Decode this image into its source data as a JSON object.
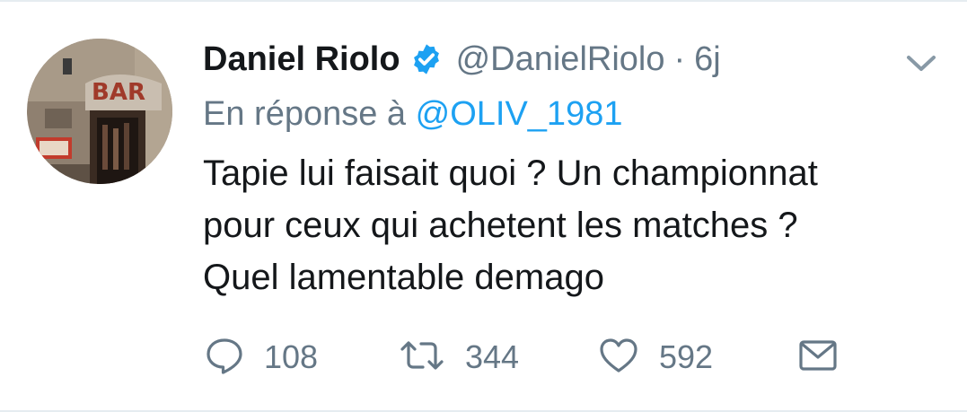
{
  "tweet": {
    "author": {
      "display_name": "Daniel Riolo",
      "handle": "@DanielRiolo",
      "verified": true
    },
    "separator": "·",
    "time": "6j",
    "reply_prefix": "En réponse à",
    "reply_to": "@OLIV_1981",
    "text_lines": [
      "Tapie lui faisait quoi ? Un championnat",
      "pour ceux qui achetent les matches ?",
      "Quel lamentable demago"
    ],
    "counts": {
      "replies": "108",
      "retweets": "344",
      "likes": "592"
    },
    "avatar_sign_text": "BAR"
  },
  "colors": {
    "name": "#14171a",
    "secondary": "#657786",
    "link": "#1da1f2",
    "verified_badge": "#1da1f2",
    "divider": "#e6ecf0"
  },
  "icons": {
    "reply": "speech-bubble-icon",
    "retweet": "retweet-arrows-icon",
    "like": "heart-icon",
    "direct_message": "envelope-icon",
    "menu": "chevron-down-icon",
    "verified": "verified-check-badge-icon"
  }
}
